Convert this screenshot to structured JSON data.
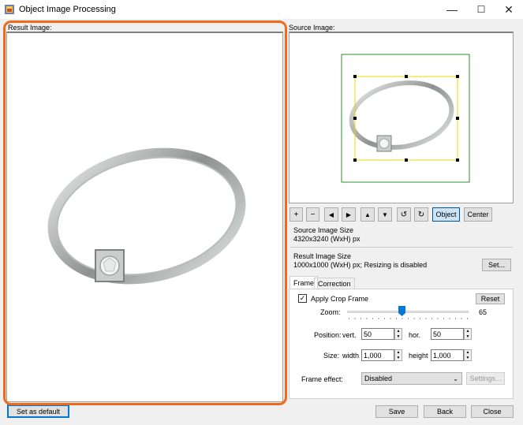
{
  "window": {
    "title": "Object Image Processing",
    "minimize_icon": "minimize-icon",
    "maximize_icon": "maximize-icon",
    "close_icon": "close-icon"
  },
  "result_panel": {
    "label": "Result Image:"
  },
  "source_panel": {
    "label": "Source Image:"
  },
  "toolbar": {
    "zoom_in": "+",
    "zoom_out": "−",
    "move_left": "◀",
    "move_right": "▶",
    "move_up": "▲",
    "move_down": "▼",
    "rotate_left": "↺",
    "rotate_right": "↻",
    "object_label": "Object",
    "center_label": "Center"
  },
  "source_size": {
    "label": "Source Image Size",
    "value": "4320x3240 (WxH) px"
  },
  "result_size": {
    "label": "Result Image Size",
    "value": "1000x1000 (WxH) px; Resizing is disabled",
    "set_label": "Set..."
  },
  "tabs": [
    {
      "label": "Frame"
    },
    {
      "label": "Correction"
    }
  ],
  "frame": {
    "apply_crop_label": "Apply Crop Frame",
    "apply_crop_checked": true,
    "reset_label": "Reset",
    "zoom_label": "Zoom:",
    "zoom_value": "65",
    "zoom_fraction": 0.45,
    "position_label": "Position:",
    "vert_label": "vert.",
    "vert_value": "50",
    "hor_label": "hor.",
    "hor_value": "50",
    "size_label": "Size:",
    "width_label": "width",
    "width_value": "1,000",
    "height_label": "height",
    "height_value": "1,000",
    "frame_effect_label": "Frame effect:",
    "frame_effect_value": "Disabled",
    "settings_label": "Settings..."
  },
  "footer": {
    "set_default_label": "Set as default",
    "save_label": "Save",
    "back_label": "Back",
    "close_label": "Close"
  }
}
